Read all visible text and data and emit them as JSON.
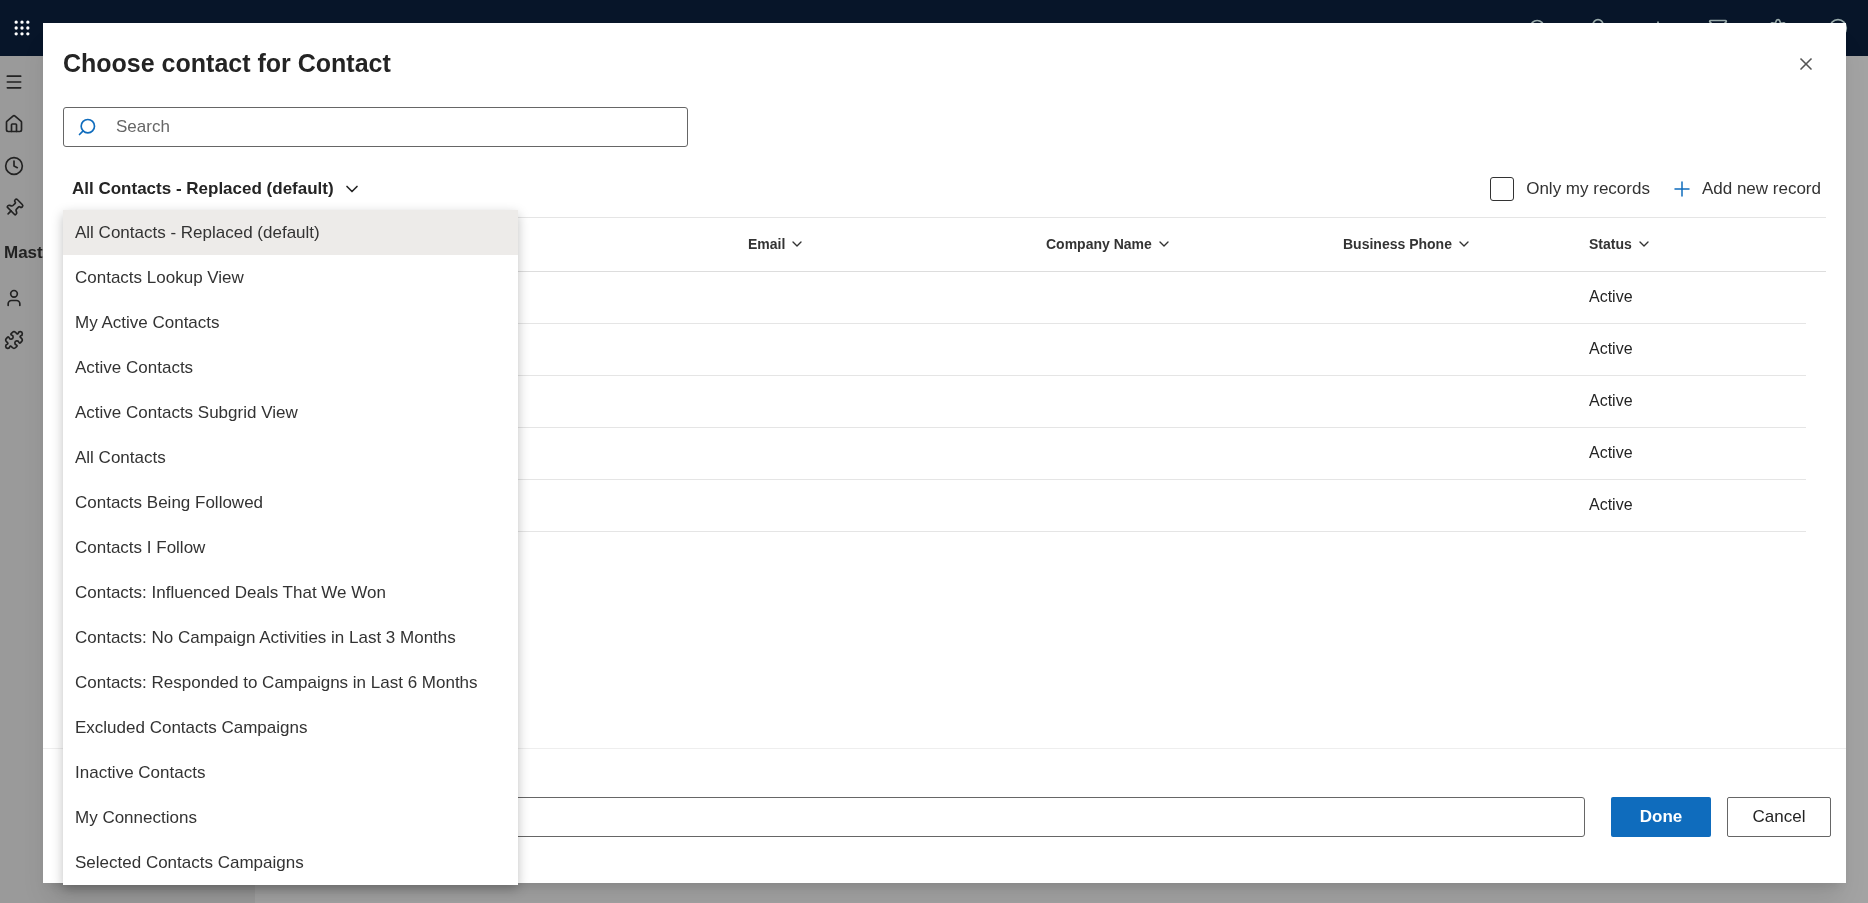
{
  "sidebar": {
    "section_label": "Mast"
  },
  "dialog": {
    "title": "Choose contact for Contact",
    "search": {
      "placeholder": "Search"
    },
    "view_selector": {
      "label": "All Contacts - Replaced (default)"
    },
    "only_my_records": {
      "label": "Only my records",
      "checked": false
    },
    "add_new_record": "Add new record",
    "columns": [
      "Email",
      "Company Name",
      "Business Phone",
      "Status"
    ],
    "rows": [
      {
        "status": "Active"
      },
      {
        "status": "Active"
      },
      {
        "status": "Active"
      },
      {
        "status": "Active"
      },
      {
        "status": "Active"
      }
    ],
    "view_menu": [
      {
        "label": "All Contacts - Replaced (default)",
        "selected": true
      },
      {
        "label": "Contacts Lookup View",
        "selected": false
      },
      {
        "label": "My Active Contacts",
        "selected": false
      },
      {
        "label": "Active Contacts",
        "selected": false
      },
      {
        "label": "Active Contacts Subgrid View",
        "selected": false
      },
      {
        "label": "All Contacts",
        "selected": false
      },
      {
        "label": "Contacts Being Followed",
        "selected": false
      },
      {
        "label": "Contacts I Follow",
        "selected": false
      },
      {
        "label": "Contacts: Influenced Deals That We Won",
        "selected": false
      },
      {
        "label": "Contacts: No Campaign Activities in Last 3 Months",
        "selected": false
      },
      {
        "label": "Contacts: Responded to Campaigns in Last 6 Months",
        "selected": false
      },
      {
        "label": "Excluded Contacts Campaigns",
        "selected": false
      },
      {
        "label": "Inactive Contacts",
        "selected": false
      },
      {
        "label": "My Connections",
        "selected": false
      },
      {
        "label": "Selected Contacts Campaigns",
        "selected": false
      }
    ],
    "buttons": {
      "done": "Done",
      "cancel": "Cancel"
    }
  }
}
